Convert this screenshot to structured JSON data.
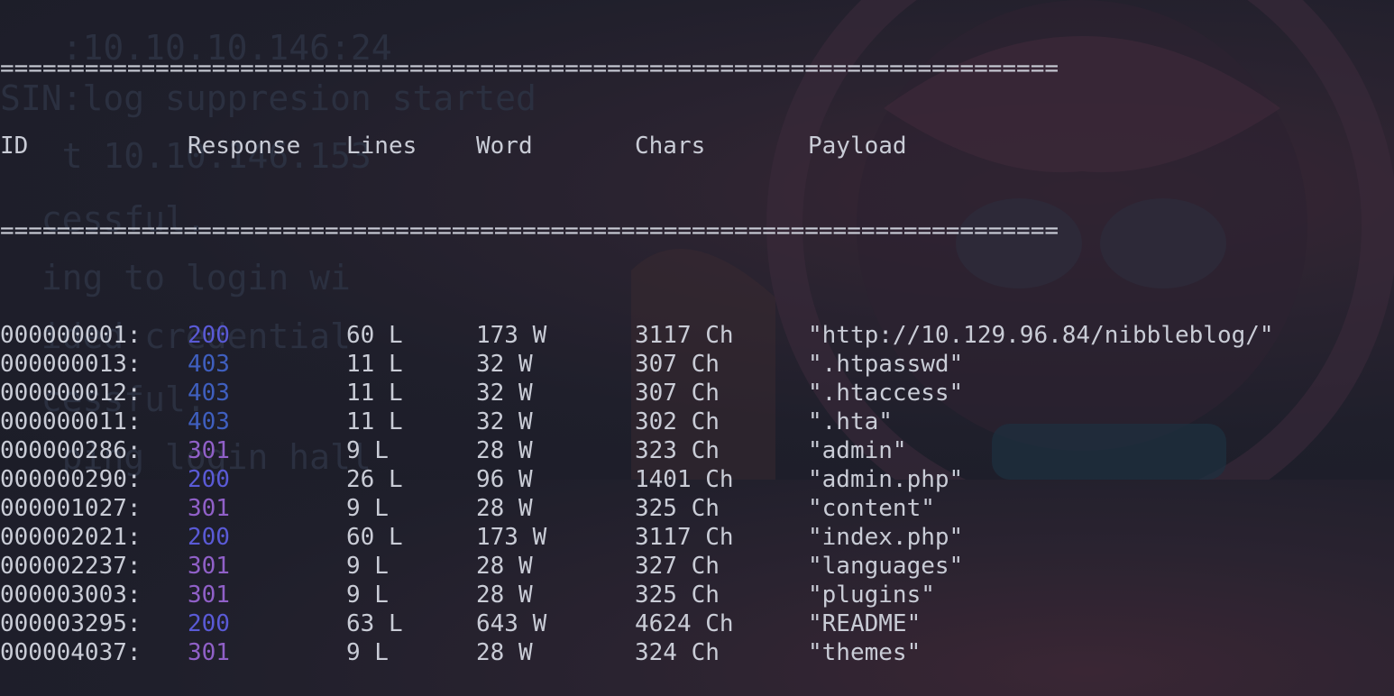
{
  "separator": "===========================================================================",
  "header": {
    "id": "ID",
    "response": "Response",
    "lines": "Lines",
    "word": "Word",
    "chars": "Chars",
    "payload": "Payload"
  },
  "colors": {
    "code_200": "#5a5ad6",
    "code_403": "#3f5fbf",
    "code_301": "#9060c8",
    "text": "#c9ccd6",
    "background": "#1f1f2b"
  },
  "rows": [
    {
      "id": "000000001:",
      "response": "200",
      "lines": "60 L",
      "word": "173 W",
      "chars": "3117 Ch",
      "payload": "\"http://10.129.96.84/nibbleblog/\""
    },
    {
      "id": "000000013:",
      "response": "403",
      "lines": "11 L",
      "word": "32 W",
      "chars": "307 Ch",
      "payload": "\".htpasswd\""
    },
    {
      "id": "000000012:",
      "response": "403",
      "lines": "11 L",
      "word": "32 W",
      "chars": "307 Ch",
      "payload": "\".htaccess\""
    },
    {
      "id": "000000011:",
      "response": "403",
      "lines": "11 L",
      "word": "32 W",
      "chars": "302 Ch",
      "payload": "\".hta\""
    },
    {
      "id": "000000286:",
      "response": "301",
      "lines": "9 L",
      "word": "28 W",
      "chars": "323 Ch",
      "payload": "\"admin\""
    },
    {
      "id": "000000290:",
      "response": "200",
      "lines": "26 L",
      "word": "96 W",
      "chars": "1401 Ch",
      "payload": "\"admin.php\""
    },
    {
      "id": "000001027:",
      "response": "301",
      "lines": "9 L",
      "word": "28 W",
      "chars": "325 Ch",
      "payload": "\"content\""
    },
    {
      "id": "000002021:",
      "response": "200",
      "lines": "60 L",
      "word": "173 W",
      "chars": "3117 Ch",
      "payload": "\"index.php\""
    },
    {
      "id": "000002237:",
      "response": "301",
      "lines": "9 L",
      "word": "28 W",
      "chars": "327 Ch",
      "payload": "\"languages\""
    },
    {
      "id": "000003003:",
      "response": "301",
      "lines": "9 L",
      "word": "28 W",
      "chars": "325 Ch",
      "payload": "\"plugins\""
    },
    {
      "id": "000003295:",
      "response": "200",
      "lines": "63 L",
      "word": "643 W",
      "chars": "4624 Ch",
      "payload": "\"README\""
    },
    {
      "id": "000004037:",
      "response": "301",
      "lines": "9 L",
      "word": "28 W",
      "chars": "324 Ch",
      "payload": "\"themes\""
    }
  ]
}
